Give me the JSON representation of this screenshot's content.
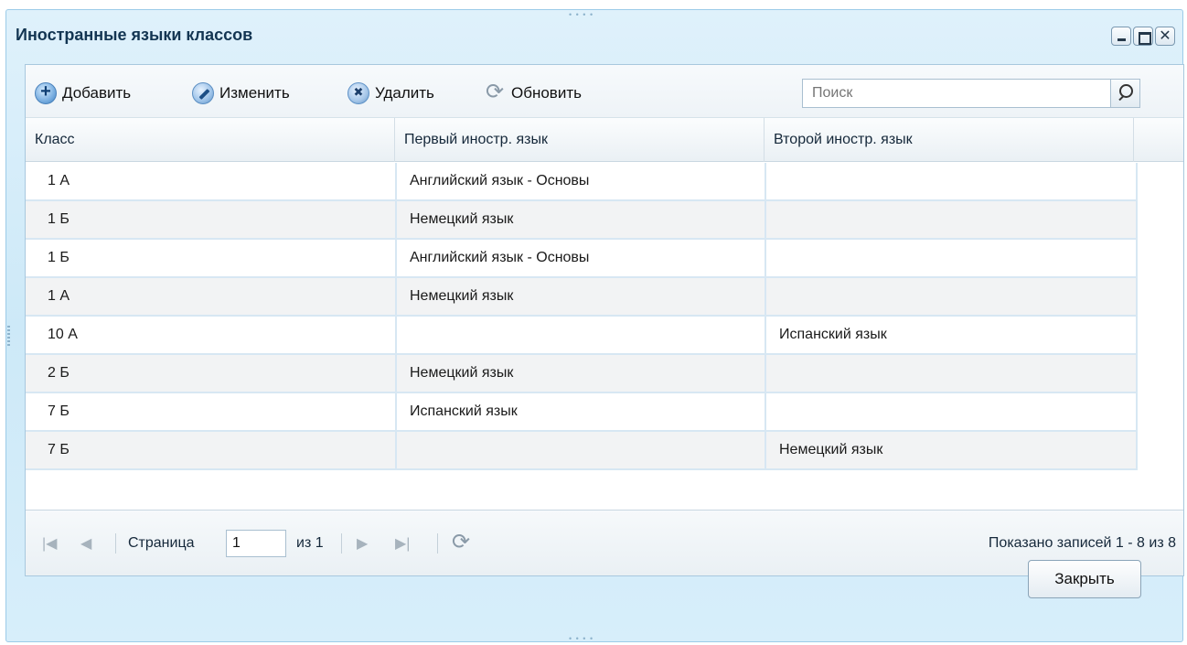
{
  "window": {
    "title": "Иностранные языки классов"
  },
  "toolbar": {
    "add_label": "Добавить",
    "edit_label": "Изменить",
    "delete_label": "Удалить",
    "refresh_label": "Обновить",
    "search_placeholder": "Поиск"
  },
  "grid": {
    "columns": [
      "Класс",
      "Первый иностр. язык",
      "Второй иностр. язык"
    ],
    "rows": [
      {
        "class": "1 А",
        "first": "Английский язык - Основы",
        "second": ""
      },
      {
        "class": "1 Б",
        "first": "Немецкий язык",
        "second": ""
      },
      {
        "class": "1 Б",
        "first": "Английский язык - Основы",
        "second": ""
      },
      {
        "class": "1 А",
        "first": "Немецкий язык",
        "second": ""
      },
      {
        "class": "10 А",
        "first": "",
        "second": "Испанский язык"
      },
      {
        "class": "2 Б",
        "first": "Немецкий язык",
        "second": ""
      },
      {
        "class": "7 Б",
        "first": "Испанский язык",
        "second": ""
      },
      {
        "class": "7 Б",
        "first": "",
        "second": "Немецкий язык"
      }
    ]
  },
  "pager": {
    "page_label": "Страница",
    "page_value": "1",
    "of_label": "из 1",
    "records_text": "Показано записей 1 - 8 из 8"
  },
  "footer": {
    "close_label": "Закрыть"
  }
}
